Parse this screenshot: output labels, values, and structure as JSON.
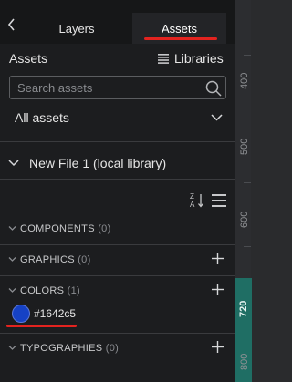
{
  "tabs": {
    "layers_label": "Layers",
    "assets_label": "Assets"
  },
  "assets": {
    "title": "Assets",
    "libraries_label": "Libraries",
    "search_placeholder": "Search assets",
    "filter_selected": "All assets"
  },
  "library": {
    "name": "New File 1 (local library)"
  },
  "sections": {
    "components": {
      "label": "COMPONENTS",
      "count": "(0)"
    },
    "graphics": {
      "label": "GRAPHICS",
      "count": "(0)"
    },
    "colors": {
      "label": "COLORS",
      "count": "(1)"
    },
    "typographies": {
      "label": "TYPOGRAPHIES",
      "count": "(0)"
    }
  },
  "colors": [
    {
      "value": "#1642c5",
      "label": "#1642c5"
    }
  ],
  "ruler": {
    "ticks": [
      "400",
      "500",
      "600",
      "720",
      "800"
    ]
  },
  "accent_colors": {
    "annotation_red": "#e3231f",
    "ruler_highlight": "#1f6e64"
  },
  "icons": {
    "back": "chevron-left-icon",
    "libraries": "list-icon",
    "search": "search-icon",
    "filter": "chevron-down-icon",
    "sort": "sort-az-icon",
    "menu": "menu-icon",
    "add": "plus-icon"
  }
}
